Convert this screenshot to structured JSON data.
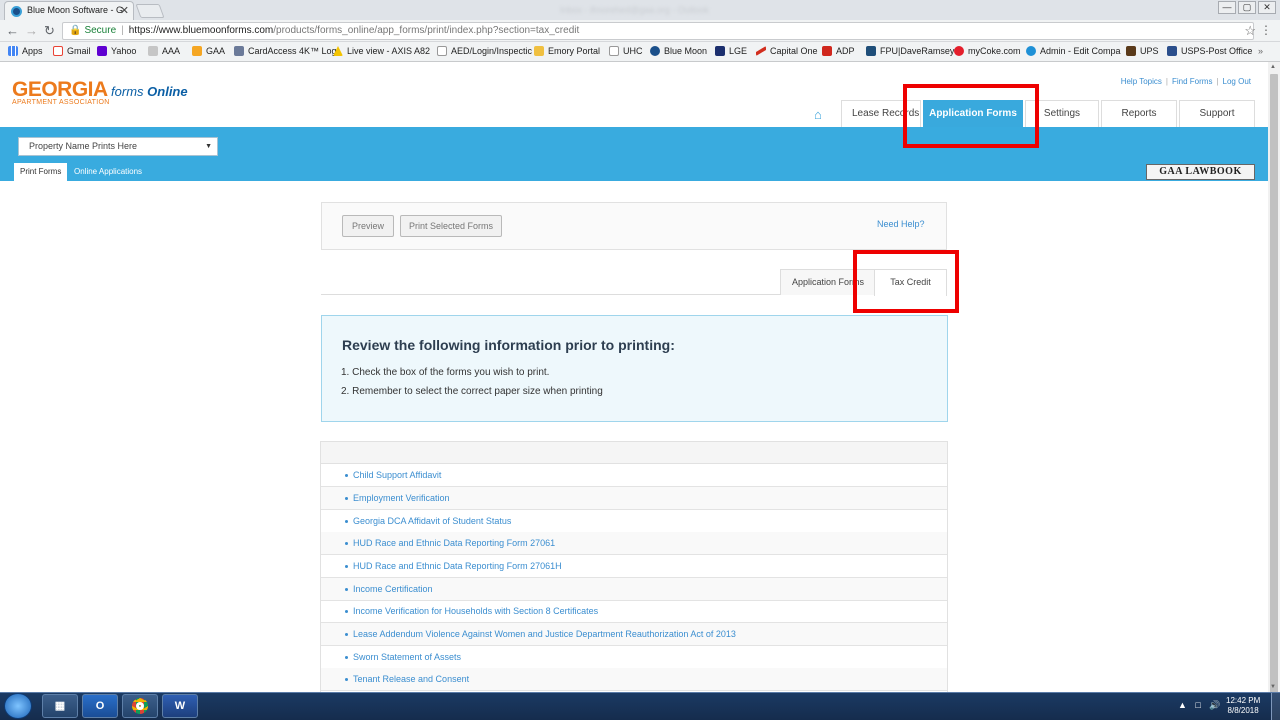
{
  "browser": {
    "tab_title": "Blue Moon Software - G",
    "tab_close": "✕",
    "blurred_title": "Inbox - ifmorehed@gaa.org - Outlook",
    "win_buttons": [
      "—",
      "▢",
      "✕"
    ],
    "secure_label": "Secure",
    "url_host": "https://www.bluemoonforms.com",
    "url_path": "/products/forms_online/app_forms/print/index.php?section=tax_credit",
    "bookmarks": [
      "Apps",
      "Gmail",
      "Yahoo",
      "AAA",
      "GAA",
      "CardAccess 4K™ Log",
      "Live view - AXIS A82",
      "AED/Login/Inspectic",
      "Emory Portal",
      "UHC",
      "Blue Moon",
      "LGE",
      "Capital One",
      "ADP",
      "FPU|DaveRamsey",
      "myCoke.com",
      "Admin - Edit Compa",
      "UPS",
      "USPS-Post Office"
    ]
  },
  "site": {
    "logo_georgia": "GEORGIA",
    "logo_forms": "forms",
    "logo_online": "Online",
    "logo_sub": "APARTMENT ASSOCIATION",
    "top_links": [
      "Help Topics",
      "Find Forms",
      "Log Out"
    ],
    "nav_tabs": [
      "Lease Records",
      "Application Forms",
      "Settings",
      "Reports",
      "Support"
    ],
    "property_select": "Property Name Prints Here",
    "sub_tabs": [
      "Print Forms",
      "Online Applications"
    ],
    "lawbook": "GAA LAWBOOK"
  },
  "content": {
    "preview_button": "Preview",
    "print_button": "Print Selected Forms",
    "need_help": "Need Help?",
    "content_tabs": [
      "Application Forms",
      "Tax Credit"
    ],
    "info_title": "Review the following information prior to printing:",
    "info_lines": [
      "1. Check the box of the forms you wish to print.",
      "2. Remember to select the correct paper size when printing"
    ],
    "forms": [
      "Child Support Affidavit",
      "Employment Verification",
      "Georgia DCA Affidavit of Student Status",
      "HUD Race and Ethnic Data Reporting Form 27061",
      "HUD Race and Ethnic Data Reporting Form 27061H",
      "Income Certification",
      "Income Verification for Households with Section 8 Certificates",
      "Lease Addendum Violence Against Women and Justice Department Reauthorization Act of 2013",
      "Sworn Statement of Assets",
      "Tenant Release and Consent"
    ]
  },
  "taskbar": {
    "time": "12:42 PM",
    "date": "8/8/2018"
  },
  "colors": {
    "accent": "#39abdf",
    "highlight": "#ee0000",
    "brand_orange": "#ec7a1c",
    "link": "#3b8ed0"
  }
}
